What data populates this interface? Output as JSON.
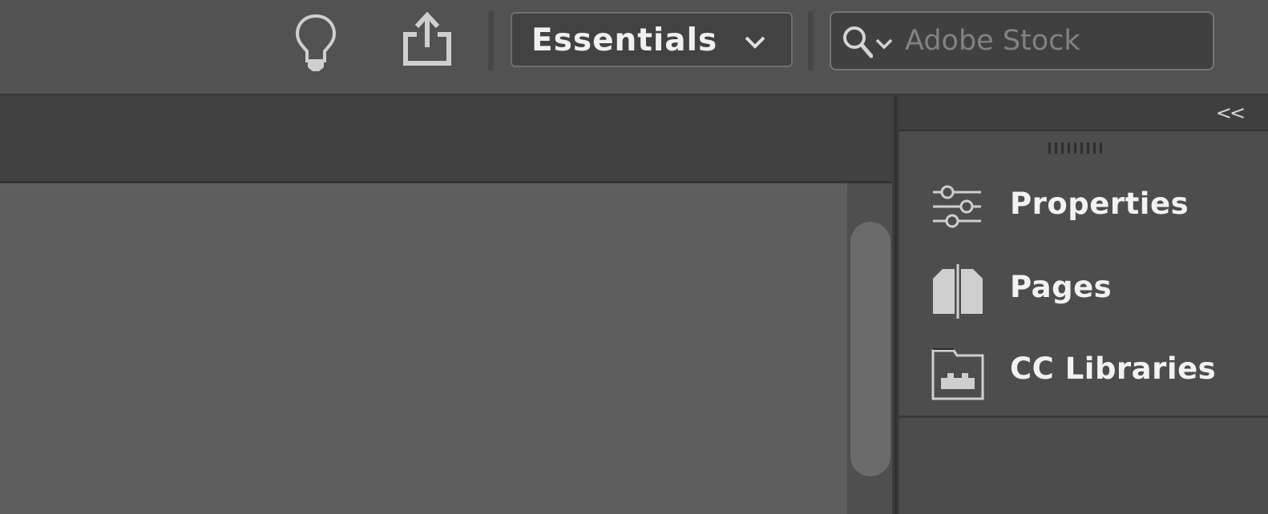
{
  "topbar": {
    "icons": [
      "lightbulb-icon",
      "share-icon"
    ],
    "workspace": {
      "label": "Essentials"
    },
    "search": {
      "placeholder": "Adobe Stock",
      "value": ""
    }
  },
  "dock": {
    "collapse_label": "<<",
    "items": [
      {
        "label": "Properties",
        "icon": "sliders-icon"
      },
      {
        "label": "Pages",
        "icon": "pages-icon"
      },
      {
        "label": "CC Libraries",
        "icon": "library-icon"
      }
    ]
  },
  "colors": {
    "app_bg": "#525252",
    "canvas": "#5e5e5e",
    "panel": "#4d4d4d",
    "text": "#f2f2f2",
    "placeholder": "#828282"
  }
}
